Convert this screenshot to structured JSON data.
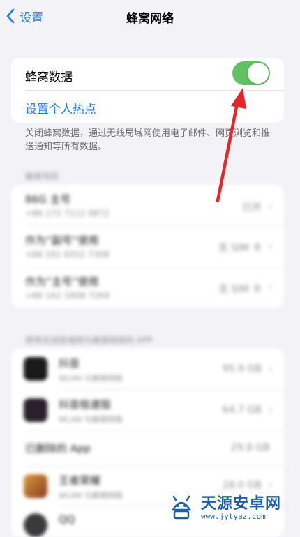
{
  "nav": {
    "back_label": "设置",
    "title": "蜂窝网络"
  },
  "cellular_card": {
    "cellular_data_label": "蜂窝数据",
    "cellular_data_on": true,
    "hotspot_label": "设置个人热点",
    "toggle_color": "#63c065",
    "link_color": "#1f7bf0"
  },
  "footnote": "关闭蜂窝数据，通过无线局域网使用电子邮件、网页浏览和推送通知等所有数据。",
  "sim_section": {
    "header": "蜂窝号码",
    "rows": [
      {
        "title": "86G 主号",
        "subtitle": "+86 172 7112 0872",
        "value": "已开"
      },
      {
        "title": "作为“副号”使用",
        "subtitle": "+86 161 6552 7308",
        "value": "无 SIM 卡"
      },
      {
        "title": "作为“主号”使用",
        "subtitle": "+86 162 1808 7269",
        "value": "无 SIM 卡"
      }
    ]
  },
  "apps_section": {
    "header": "使用无线局域网与蜂窝网络的 APP",
    "rows": [
      {
        "name": "抖音",
        "sub": "WLAN 与蜂窝网络",
        "size": "95.9 GB",
        "icon": "douyin-icon"
      },
      {
        "name": "抖音极速版",
        "sub": "WLAN 与蜂窝网络",
        "size": "64.7 GB",
        "icon": "douyin-lite-icon"
      },
      {
        "name": "已删除的 App",
        "sub": "",
        "size": "29.8 GB",
        "icon": ""
      },
      {
        "name": "王者荣耀",
        "sub": "WLAN 与蜂窝网络",
        "size": "28.0 GB",
        "icon": "game-icon"
      },
      {
        "name": "QQ",
        "sub": "",
        "size": "",
        "icon": "qq-icon"
      }
    ]
  },
  "watermark": {
    "name": "天源安卓网",
    "url": "www.jytyaz.com"
  }
}
